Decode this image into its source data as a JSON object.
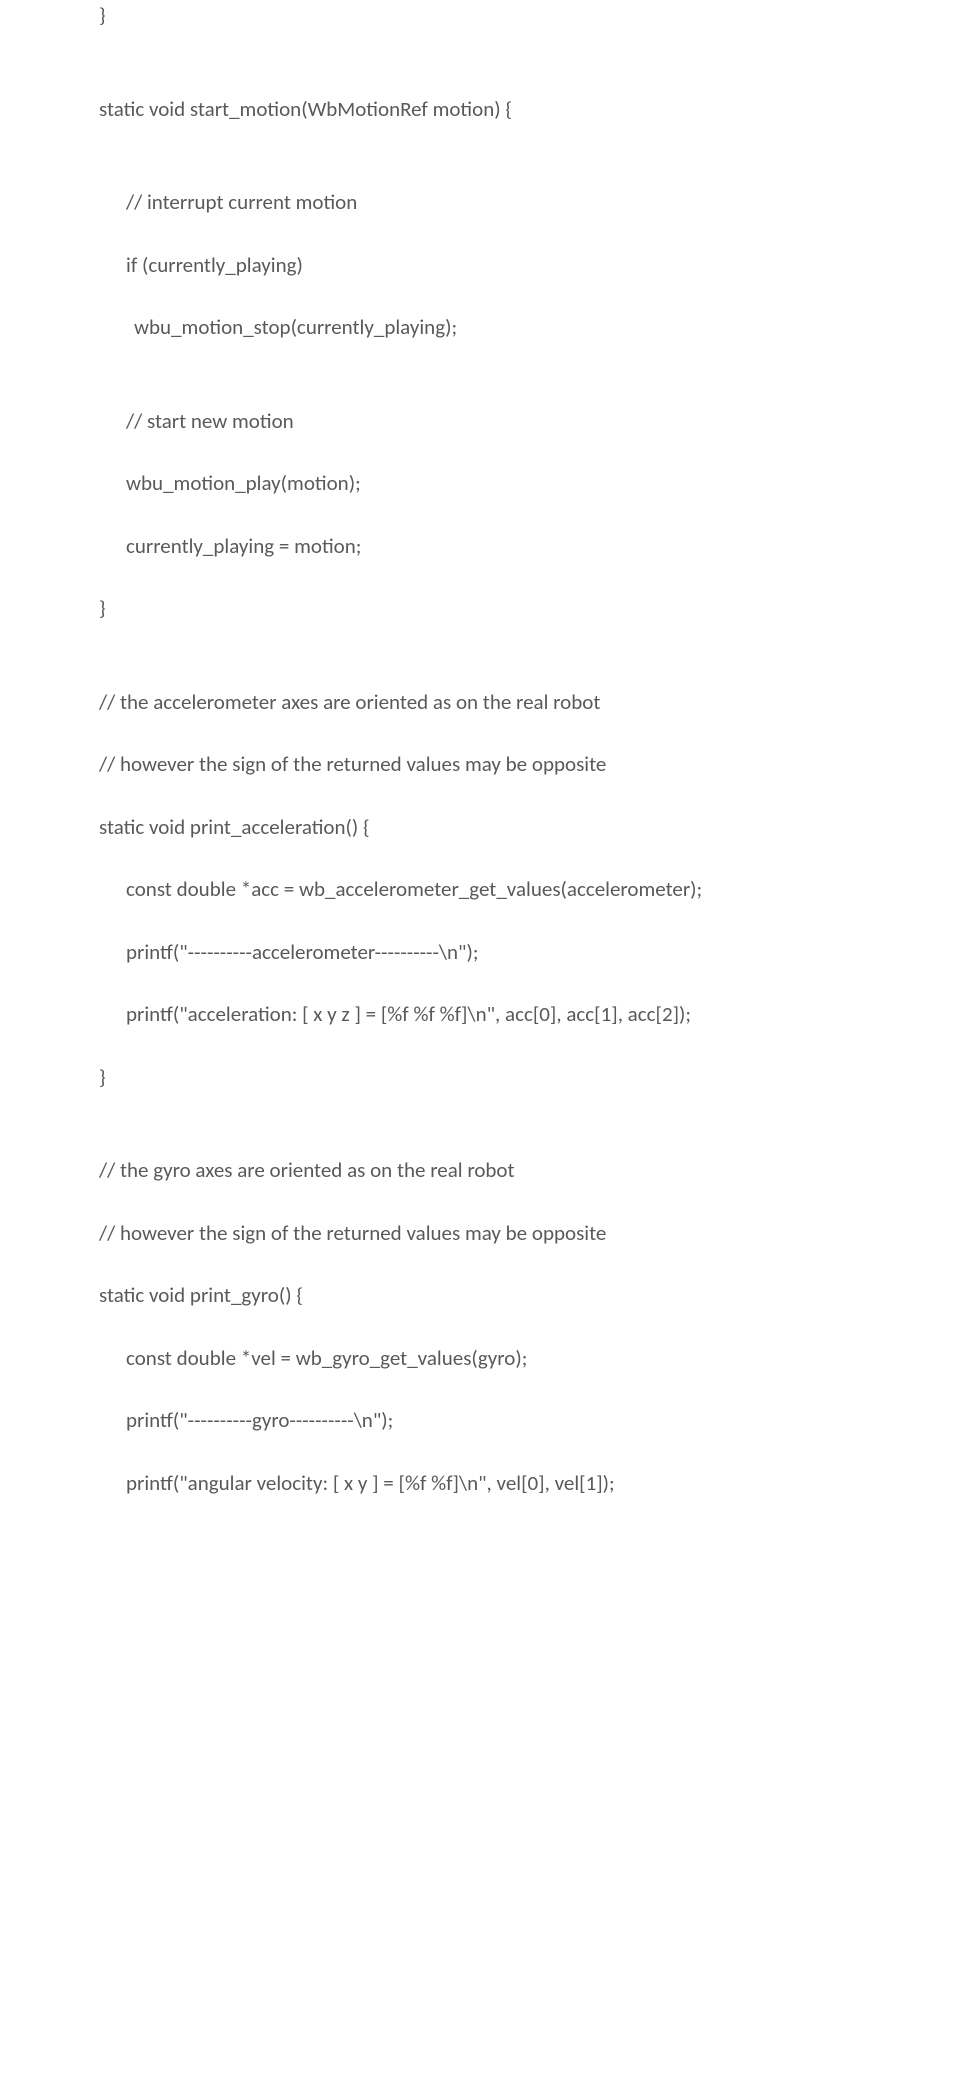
{
  "lines": [
    {
      "text": "}",
      "indent": 0
    },
    {
      "blank": true
    },
    {
      "blank": true
    },
    {
      "text": "static void start_motion(WbMotionRef motion) {",
      "indent": 0
    },
    {
      "blank": true
    },
    {
      "blank": true
    },
    {
      "text": "// interrupt current motion",
      "indent": 1
    },
    {
      "blank": true
    },
    {
      "text": "if (currently_playing)",
      "indent": 1
    },
    {
      "blank": true
    },
    {
      "text": "wbu_motion_stop(currently_playing);",
      "indent": 2
    },
    {
      "blank": true
    },
    {
      "blank": true
    },
    {
      "text": "// start new motion",
      "indent": 1
    },
    {
      "blank": true
    },
    {
      "text": "wbu_motion_play(motion);",
      "indent": 1
    },
    {
      "blank": true
    },
    {
      "text": "currently_playing = motion;",
      "indent": 1
    },
    {
      "blank": true
    },
    {
      "text": "}",
      "indent": 0
    },
    {
      "blank": true
    },
    {
      "blank": true
    },
    {
      "text": "// the accelerometer axes are oriented as on the real robot",
      "indent": 0
    },
    {
      "blank": true
    },
    {
      "text": "// however the sign of the returned values may be opposite",
      "indent": 0
    },
    {
      "blank": true
    },
    {
      "text": "static void print_acceleration() {",
      "indent": 0
    },
    {
      "blank": true
    },
    {
      "text": "const double *acc = wb_accelerometer_get_values(accelerometer);",
      "indent": 1
    },
    {
      "blank": true
    },
    {
      "text": "printf(\"----------accelerometer----------\\n\");",
      "indent": 1
    },
    {
      "blank": true
    },
    {
      "text": "printf(\"acceleration: [ x y z ] = [%f %f %f]\\n\", acc[0], acc[1], acc[2]);",
      "indent": 1
    },
    {
      "blank": true
    },
    {
      "text": "}",
      "indent": 0
    },
    {
      "blank": true
    },
    {
      "blank": true
    },
    {
      "text": "// the gyro axes are oriented as on the real robot",
      "indent": 0
    },
    {
      "blank": true
    },
    {
      "text": "// however the sign of the returned values may be opposite",
      "indent": 0
    },
    {
      "blank": true
    },
    {
      "text": "static void print_gyro() {",
      "indent": 0
    },
    {
      "blank": true
    },
    {
      "text": "const double *vel = wb_gyro_get_values(gyro);",
      "indent": 1
    },
    {
      "blank": true
    },
    {
      "text": "printf(\"----------gyro----------\\n\");",
      "indent": 1
    },
    {
      "blank": true
    },
    {
      "text": "printf(\"angular velocity: [ x y ] = [%f %f]\\n\", vel[0], vel[1]);",
      "indent": 1
    }
  ]
}
